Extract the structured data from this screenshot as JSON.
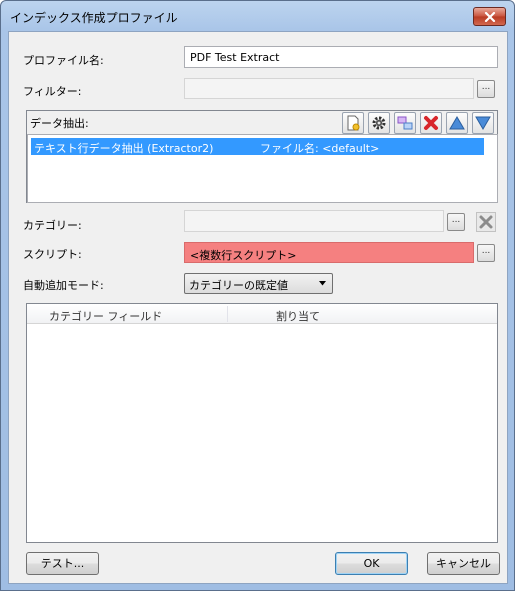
{
  "window": {
    "title": "インデックス作成プロファイル"
  },
  "profile": {
    "label": "プロファイル名:",
    "value": "PDF Test Extract"
  },
  "filter": {
    "label": "フィルター:",
    "value": "",
    "browse_label": "..."
  },
  "extraction": {
    "label": "データ抽出:",
    "toolbar": [
      "new-doc-icon",
      "gear-icon",
      "swap-icon",
      "delete-x-icon",
      "arrow-up-icon",
      "arrow-down-icon"
    ],
    "rows": [
      {
        "name": "テキスト行データ抽出 (Extractor2)",
        "file": "ファイル名: <default>"
      }
    ]
  },
  "category": {
    "label": "カテゴリー:",
    "value": "",
    "browse_label": "..."
  },
  "script": {
    "label": "スクリプト:",
    "value": "<複数行スクリプト>",
    "browse_label": "...",
    "highlight_color": "#f58080"
  },
  "auto_add": {
    "label": "自動追加モード:",
    "selected": "カテゴリーの既定値"
  },
  "grid": {
    "columns": [
      "カテゴリー フィールド",
      "割り当て"
    ]
  },
  "buttons": {
    "test": "テスト...",
    "ok": "OK",
    "cancel": "キャンセル"
  }
}
